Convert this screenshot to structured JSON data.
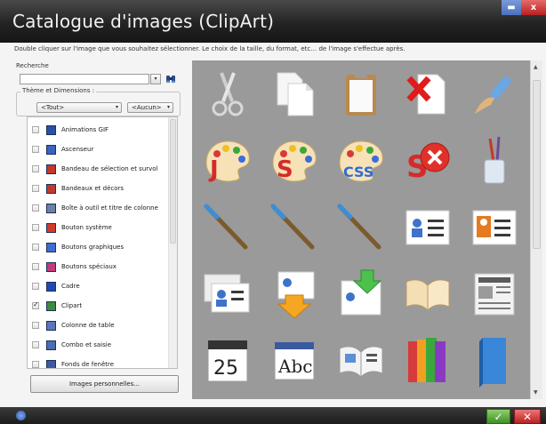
{
  "window": {
    "title": "Catalogue d'images (ClipArt)",
    "minimize_icon": "minimize-icon",
    "close_icon": "close-icon",
    "close_glyph": "x"
  },
  "instruction": "Double cliquer sur l'image que vous souhaitez sélectionner. Le choix de la taille, du format, etc… de l'image s'effectue après.",
  "search": {
    "label": "Recherche",
    "value": "",
    "dropdown_glyph": "▾",
    "button_icon": "binoculars-icon"
  },
  "filters": {
    "group_title": "Thème et Dimensions :",
    "theme_value": "<Tout>",
    "dimension_value": "<Aucun>",
    "arrow_glyph": "▾"
  },
  "theme_list": [
    {
      "label": "Animations GIF",
      "checked": false,
      "icon": "gif-animation-icon",
      "color": "#2b4fa8"
    },
    {
      "label": "Ascenseur",
      "checked": false,
      "icon": "elevator-icon",
      "color": "#3a63c4"
    },
    {
      "label": "Bandeau de sélection et survol",
      "checked": false,
      "icon": "selection-banner-icon",
      "color": "#c0392b"
    },
    {
      "label": "Bandeaux et décors",
      "checked": false,
      "icon": "banner-decor-icon",
      "color": "#c0392b"
    },
    {
      "label": "Boîte à outil et titre de colonne",
      "checked": false,
      "icon": "toolbox-icon",
      "color": "#6d7fa7"
    },
    {
      "label": "Bouton système",
      "checked": false,
      "icon": "system-button-icon",
      "color": "#d13a2a"
    },
    {
      "label": "Boutons graphiques",
      "checked": false,
      "icon": "graphic-buttons-icon",
      "color": "#3e6ccf"
    },
    {
      "label": "Boutons spéciaux",
      "checked": false,
      "icon": "special-buttons-icon",
      "color": "#c23b7a"
    },
    {
      "label": "Cadre",
      "checked": false,
      "icon": "frame-icon",
      "color": "#2148b0"
    },
    {
      "label": "Clipart",
      "checked": true,
      "icon": "clipart-icon",
      "color": "#3d8b3d"
    },
    {
      "label": "Colonne de table",
      "checked": false,
      "icon": "table-column-icon",
      "color": "#5a76b8"
    },
    {
      "label": "Combo et saisie",
      "checked": false,
      "icon": "combo-input-icon",
      "color": "#4a6cb2"
    },
    {
      "label": "Fonds de fenêtre",
      "checked": false,
      "icon": "window-background-icon",
      "color": "#3b5aa0"
    }
  ],
  "personal_images_button": "Images personnelles...",
  "gallery": [
    {
      "name": "scissors-clipart",
      "icon": "scissors-icon"
    },
    {
      "name": "copy-documents-clipart",
      "icon": "documents-icon"
    },
    {
      "name": "clipboard-clipart",
      "icon": "clipboard-icon"
    },
    {
      "name": "delete-document-clipart",
      "icon": "delete-document-icon"
    },
    {
      "name": "brush-clipart",
      "icon": "brush-icon"
    },
    {
      "name": "palette-j-clipart",
      "icon": "palette-j-icon",
      "letter": "J"
    },
    {
      "name": "palette-s-clipart",
      "icon": "palette-s-icon",
      "letter": "S"
    },
    {
      "name": "palette-css-clipart",
      "icon": "palette-css-icon",
      "letter": "CSS"
    },
    {
      "name": "s-delete-clipart",
      "icon": "s-delete-icon",
      "letter": "S"
    },
    {
      "name": "brush-cup-clipart",
      "icon": "brush-cup-icon"
    },
    {
      "name": "paintbrush-1-clipart",
      "icon": "paintbrush-icon"
    },
    {
      "name": "paintbrush-2-clipart",
      "icon": "paintbrush-icon"
    },
    {
      "name": "paintbrush-3-clipart",
      "icon": "paintbrush-icon"
    },
    {
      "name": "contact-card-clipart",
      "icon": "contact-card-icon"
    },
    {
      "name": "contact-card-orange-clipart",
      "icon": "contact-card-orange-icon"
    },
    {
      "name": "contact-cards-clipart",
      "icon": "contact-cards-icon"
    },
    {
      "name": "contact-download-clipart",
      "icon": "contact-download-icon"
    },
    {
      "name": "contact-import-clipart",
      "icon": "contact-import-icon"
    },
    {
      "name": "open-book-clipart",
      "icon": "open-book-icon"
    },
    {
      "name": "newspaper-clipart",
      "icon": "newspaper-icon"
    },
    {
      "name": "calendar-clipart",
      "icon": "calendar-icon",
      "text": "25"
    },
    {
      "name": "text-field-clipart",
      "icon": "text-field-icon",
      "text": "Abc"
    },
    {
      "name": "picture-book-clipart",
      "icon": "picture-book-icon"
    },
    {
      "name": "color-books-clipart",
      "icon": "color-books-icon"
    },
    {
      "name": "blue-book-clipart",
      "icon": "blue-book-icon"
    }
  ],
  "footer": {
    "help_icon": "help-icon",
    "ok_icon": "ok-check-icon",
    "ok_glyph": "✓",
    "cancel_icon": "cancel-x-icon",
    "cancel_glyph": "✕"
  }
}
